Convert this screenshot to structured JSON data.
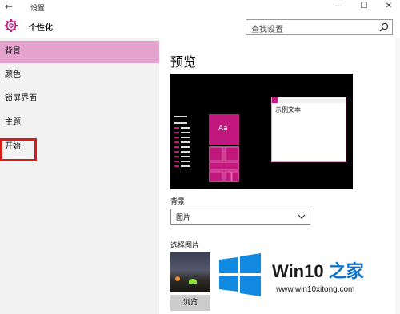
{
  "window": {
    "title": "设置",
    "back_glyph": "←",
    "minimize_glyph": "—",
    "maximize_glyph": "☐",
    "close_glyph": "✕"
  },
  "header": {
    "app_icon": "gear-icon",
    "app_name": "个性化",
    "search_placeholder": "查找设置",
    "search_icon": "search-icon"
  },
  "sidebar": {
    "items": [
      {
        "label": "背景",
        "active": true
      },
      {
        "label": "颜色",
        "active": false
      },
      {
        "label": "锁屏界面",
        "active": false
      },
      {
        "label": "主题",
        "active": false
      },
      {
        "label": "开始",
        "active": false
      }
    ],
    "highlight_color": "#d51b1b"
  },
  "main": {
    "heading": "预览",
    "preview": {
      "tile_label": "Aa",
      "window_text": "示例文本",
      "accent_color": "#c2187d"
    },
    "background_label": "背景",
    "background_value": "图片",
    "choose_picture_label": "选择图片",
    "browse_button": "浏览"
  },
  "watermark": {
    "brand_prefix": "Win10",
    "brand_suffix": " 之家",
    "url": "www.win10xitong.com"
  },
  "colors": {
    "accent": "#c2187d",
    "active_nav": "#e3a3cc",
    "sidebar_bg": "#f2f2f2"
  }
}
